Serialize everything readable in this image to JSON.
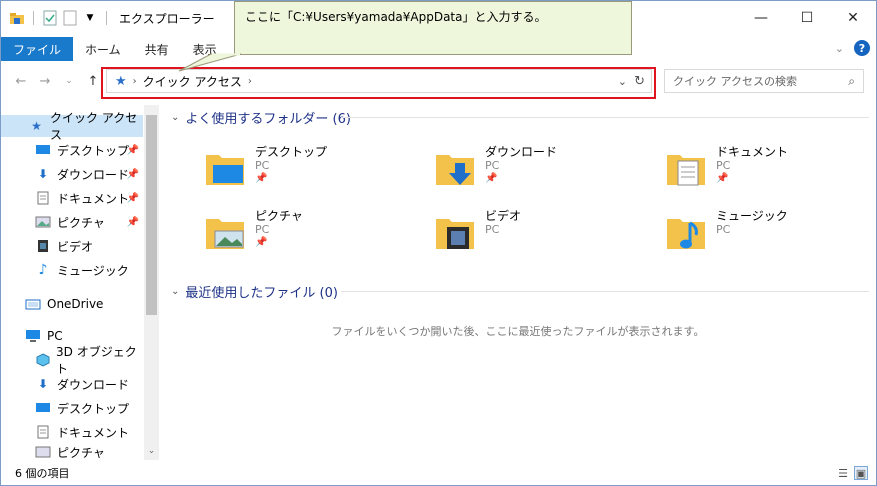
{
  "window": {
    "title": "エクスプローラー"
  },
  "ribbon": {
    "tabs": [
      "ファイル",
      "ホーム",
      "共有",
      "表示"
    ]
  },
  "callout": {
    "text": "ここに「C:¥Users¥yamada¥AppData」と入力する。"
  },
  "address": {
    "crumb": "クイック アクセス"
  },
  "search": {
    "placeholder": "クイック アクセスの検索"
  },
  "sidebar": {
    "items": [
      {
        "label": "クイック アクセス",
        "icon": "star-icon"
      },
      {
        "label": "デスクトップ",
        "icon": "desktop-icon",
        "pinned": true
      },
      {
        "label": "ダウンロード",
        "icon": "download-icon",
        "pinned": true
      },
      {
        "label": "ドキュメント",
        "icon": "document-icon",
        "pinned": true
      },
      {
        "label": "ピクチャ",
        "icon": "picture-icon",
        "pinned": true
      },
      {
        "label": "ビデオ",
        "icon": "video-icon"
      },
      {
        "label": "ミュージック",
        "icon": "music-icon"
      },
      {
        "label": "OneDrive",
        "icon": "onedrive-icon"
      },
      {
        "label": "PC",
        "icon": "pc-icon"
      },
      {
        "label": "3D オブジェクト",
        "icon": "cube-icon"
      },
      {
        "label": "ダウンロード",
        "icon": "download-icon"
      },
      {
        "label": "デスクトップ",
        "icon": "desktop-icon"
      },
      {
        "label": "ドキュメント",
        "icon": "document-icon"
      },
      {
        "label": "ピクチャ",
        "icon": "picture-icon"
      }
    ]
  },
  "content": {
    "frequent_header": "よく使用するフォルダー (6)",
    "recent_header": "最近使用したファイル (0)",
    "empty_message": "ファイルをいくつか開いた後、ここに最近使ったファイルが表示されます。",
    "folders": [
      {
        "name": "デスクトップ",
        "location": "PC",
        "pinned": true,
        "icon": "desktop-folder-icon"
      },
      {
        "name": "ダウンロード",
        "location": "PC",
        "pinned": true,
        "icon": "download-folder-icon"
      },
      {
        "name": "ドキュメント",
        "location": "PC",
        "pinned": true,
        "icon": "document-folder-icon"
      },
      {
        "name": "ピクチャ",
        "location": "PC",
        "pinned": true,
        "icon": "picture-folder-icon"
      },
      {
        "name": "ビデオ",
        "location": "PC",
        "pinned": false,
        "icon": "video-folder-icon"
      },
      {
        "name": "ミュージック",
        "location": "PC",
        "pinned": false,
        "icon": "music-folder-icon"
      }
    ]
  },
  "status": {
    "count": "6 個の項目"
  },
  "colors": {
    "accent": "#1979ca",
    "highlight": "#e0141e",
    "callout_bg": "#eef6dc",
    "header_text": "#1e3287"
  }
}
